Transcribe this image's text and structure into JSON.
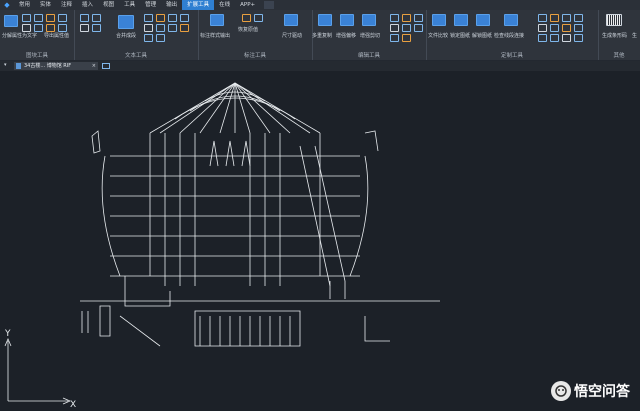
{
  "menu": {
    "items": [
      "常用",
      "实体",
      "注释",
      "插入",
      "视图",
      "工具",
      "管理",
      "输出",
      "扩展工具",
      "在线",
      "APP+"
    ],
    "active_index": 8
  },
  "ribbon": {
    "groups": [
      {
        "label": "图块工具",
        "buttons": [
          "分解属性为文字",
          "导出属性值"
        ]
      },
      {
        "label": "文本工具",
        "buttons": [
          "合并成段"
        ]
      },
      {
        "label": "标注工具",
        "buttons": [
          "标注样式输出",
          "恢复原值",
          "尺寸驱动"
        ]
      },
      {
        "label": "编辑工具",
        "buttons": [
          "多重复制",
          "增强偏移",
          "增强剪切"
        ]
      },
      {
        "label": "定制工具",
        "buttons": [
          "文件比较",
          "锁定图纸",
          "解锁图纸",
          "检查线段连接"
        ]
      },
      {
        "label": "其他",
        "buttons": [
          "生成条形码",
          "生"
        ]
      }
    ]
  },
  "doc_tab": {
    "title": "34古楼...  博物馆 RIF"
  },
  "axis": {
    "x_label": "X",
    "y_label": "Y"
  },
  "watermark": {
    "text": "悟空问答"
  },
  "colors": {
    "accent": "#2f7fd1",
    "canvas": "#1c2128",
    "drawing_line": "#e8ecef"
  }
}
